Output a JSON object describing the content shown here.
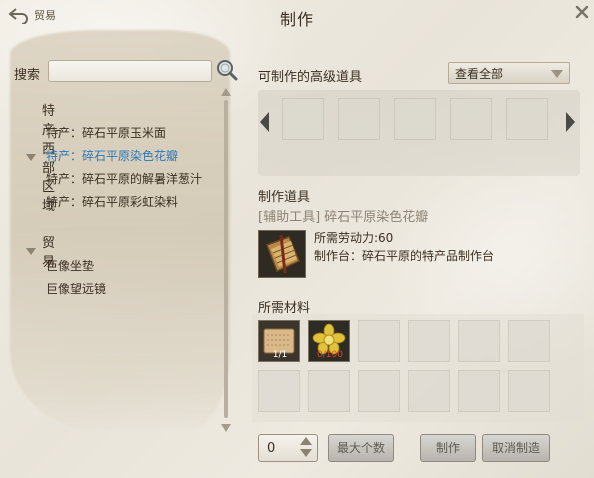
{
  "window": {
    "title": "制作",
    "back_label": "贸易"
  },
  "search": {
    "label": "搜索",
    "value": "",
    "placeholder": ""
  },
  "tree": {
    "groups": [
      {
        "label": "特产–西部区域",
        "items": [
          {
            "label": "特产：碎石平原玉米面",
            "selected": false
          },
          {
            "label": "特产：碎石平原染色花瓣",
            "selected": true
          },
          {
            "label": "特产：碎石平原的解暑洋葱汁",
            "selected": false
          },
          {
            "label": "特产：碎石平原彩虹染料",
            "selected": false
          }
        ]
      },
      {
        "label": "贸易",
        "items": [
          {
            "label": "巨像坐垫",
            "selected": false
          },
          {
            "label": "巨像望远镜",
            "selected": false
          }
        ]
      }
    ]
  },
  "advanced": {
    "label": "可制作的高级道具",
    "filter": "查看全部"
  },
  "craft_item": {
    "section_label": "制作道具",
    "name": "[辅助工具] 碎石平原染色花瓣",
    "labor_cost": "所需劳动力:60",
    "station": "制作台：碎石平原的特产品制作台",
    "icon": "wrapped-parcel-icon"
  },
  "materials": {
    "label": "所需材料",
    "items": [
      {
        "icon": "grain-sack-icon",
        "count": "1/1"
      },
      {
        "icon": "yellow-flower-icon",
        "count": "0/100"
      }
    ]
  },
  "controls": {
    "quantity": "0",
    "max_label": "最大个数",
    "craft_label": "制作",
    "cancel_label": "取消制造"
  },
  "colors": {
    "selected_text": "#2f78b8",
    "shortage_text": "#d24a2c",
    "item_name_text": "#8c8374"
  }
}
